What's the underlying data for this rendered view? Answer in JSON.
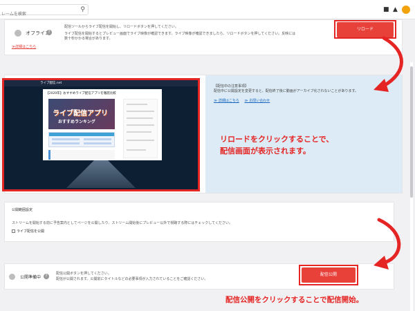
{
  "colors": {
    "accent": "#e8413a",
    "annotation": "#e52424",
    "notes_bg": "#dcebf5",
    "status_idle": "#bdbdbd"
  },
  "header": {
    "search_placeholder": "レームを検索",
    "icons": [
      "search-icon",
      "camera-icon",
      "bell-icon",
      "avatar"
    ]
  },
  "status": {
    "label": "オフライン",
    "message_line1": "配信ツールからライブ配信を開始し、リロードボタンを押してください。",
    "message_line2": "ライブ配信を開始するとプレビュー画面でライブ映像が確認できます。ライブ映像が確認できましたら、リロードボタンを押してください。反映には数十秒かかる場合があります。",
    "detail_link": "≫詳細はこちら",
    "reload_button": "リロード"
  },
  "preview": {
    "browser_title": "ライブ配信.net",
    "page_title": "【2020年】おすすめライブ配信アプリを徹底比較",
    "banner_main": "ライブ配信アプリ",
    "banner_sub": "おすすめランキング"
  },
  "notes": {
    "title": "【配信中の注意事項】",
    "body": "配信中に公開設定を変更すると、配信終了後に動画がアーカイブ化されないことがあります。",
    "link1": "≫ 詳細はこちら",
    "link2": "≫ お問い合わせ"
  },
  "annotations": {
    "reload_line1": "リロードをクリックすることで、",
    "reload_line2": "配信画面が表示されます。",
    "publish": "配信公開をクリックすることで配信開始。"
  },
  "public_settings": {
    "title": "公開範囲設定",
    "description": "ストリームを開始する前に予告案内としてページを公開したり、ストリーム開始後にプレビュー以外で視聴する際にはチェックしてください。",
    "checkbox_label": "ライブ配信を公開",
    "checkbox_checked": false
  },
  "prep": {
    "label": "公開準備中",
    "message_line1": "配信公開ボタンを押してください。",
    "message_line2": "配信が公開されます。公開前にタイトルなどの必要事項が入力されていることをご確認ください。",
    "publish_button": "配信公開"
  }
}
